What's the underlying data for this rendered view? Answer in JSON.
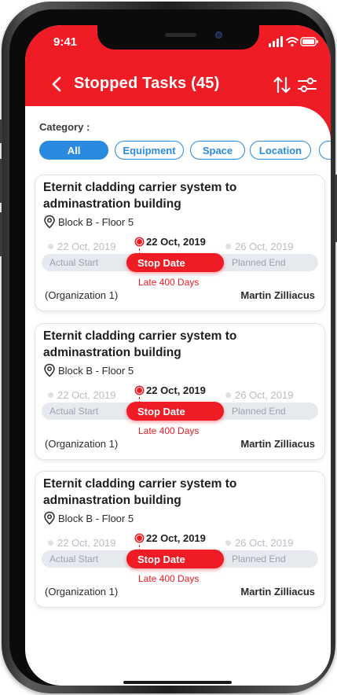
{
  "status_bar": {
    "time": "9:41"
  },
  "header": {
    "title": "Stopped Tasks (45)"
  },
  "category": {
    "label": "Category :",
    "chips": [
      "All",
      "Equipment",
      "Space",
      "Location",
      ""
    ],
    "selected": "All"
  },
  "tasks": [
    {
      "title": "Eternit cladding carrier system to adminastration building",
      "location": "Block B - Floor 5",
      "actual_start_date": "22 Oct, 2019",
      "stop_date": "22 Oct, 2019",
      "planned_end_date": "26 Oct, 2019",
      "actual_start_label": "Actual Start",
      "stop_label": "Stop Date",
      "planned_end_label": "Planned End",
      "late_text": "Late 400 Days",
      "organization": "(Organization 1)",
      "assignee": "Martin Zilliacus"
    },
    {
      "title": "Eternit cladding carrier system to adminastration building",
      "location": "Block B - Floor 5",
      "actual_start_date": "22 Oct, 2019",
      "stop_date": "22 Oct, 2019",
      "planned_end_date": "26 Oct, 2019",
      "actual_start_label": "Actual Start",
      "stop_label": "Stop Date",
      "planned_end_label": "Planned End",
      "late_text": "Late 400 Days",
      "organization": "(Organization 1)",
      "assignee": "Martin Zilliacus"
    },
    {
      "title": "Eternit cladding carrier system to adminastration building",
      "location": "Block B - Floor 5",
      "actual_start_date": "22 Oct, 2019",
      "stop_date": "22 Oct, 2019",
      "planned_end_date": "26 Oct, 2019",
      "actual_start_label": "Actual Start",
      "stop_label": "Stop Date",
      "planned_end_label": "Planned End",
      "late_text": "Late 400 Days",
      "organization": "(Organization 1)",
      "assignee": "Martin Zilliacus"
    }
  ],
  "icons": {
    "back": "chevron-left-icon",
    "sort": "sort-arrows-icon",
    "filter": "sliders-icon",
    "location": "map-pin-icon",
    "signal": "signal-icon",
    "wifi": "wifi-icon",
    "battery": "battery-icon"
  },
  "colors": {
    "primary": "#ef1c25",
    "accent": "#2a8ae0",
    "track": "#e6eaee"
  }
}
